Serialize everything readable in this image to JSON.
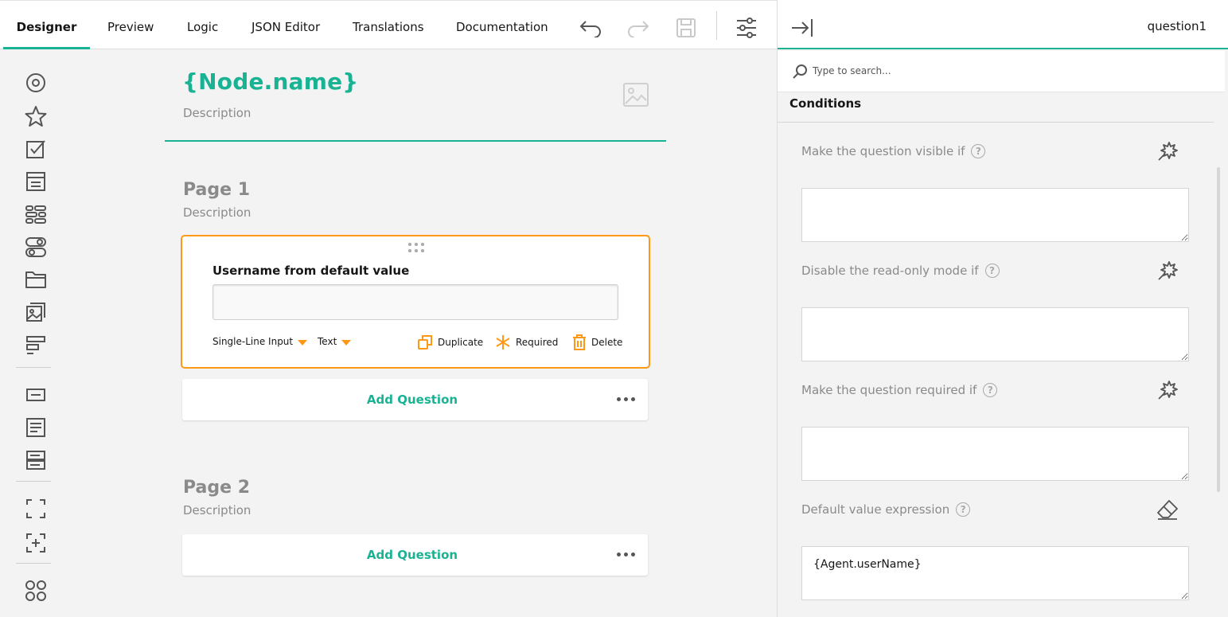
{
  "tabs": [
    {
      "label": "Designer"
    },
    {
      "label": "Preview"
    },
    {
      "label": "Logic"
    },
    {
      "label": "JSON Editor"
    },
    {
      "label": "Translations"
    },
    {
      "label": "Documentation"
    }
  ],
  "toolbar_icons": [
    "undo-icon",
    "redo-icon",
    "save-icon",
    "settings-sliders-icon"
  ],
  "toolbox_icons": [
    "radiogroup-icon",
    "rating-icon",
    "checkbox-icon",
    "dropdown-icon",
    "tagbox-icon",
    "boolean-icon",
    "file-icon",
    "image-picker-icon",
    "ranking-icon",
    "text-input-icon",
    "comment-icon",
    "multiple-text-icon",
    "panel-icon",
    "dynamic-panel-icon",
    "matrix-icon"
  ],
  "survey": {
    "title": "{Node.name}",
    "description": "Description"
  },
  "pages": [
    {
      "title": "Page 1",
      "description": "Description",
      "add_question": "Add Question"
    },
    {
      "title": "Page 2",
      "description": "Description",
      "add_question": "Add Question"
    }
  ],
  "question": {
    "title": "Username from default value",
    "type_label": "Single-Line Input",
    "input_type_label": "Text",
    "duplicate_label": "Duplicate",
    "required_label": "Required",
    "delete_label": "Delete"
  },
  "right_panel": {
    "selected_name": "question1",
    "search_placeholder": "Type to search...",
    "section": "Conditions",
    "properties": [
      {
        "label": "Make the question visible if",
        "value": ""
      },
      {
        "label": "Disable the read-only mode if",
        "value": ""
      },
      {
        "label": "Make the question required if",
        "value": ""
      },
      {
        "label": "Default value expression",
        "value": "{Agent.userName}"
      }
    ],
    "help_glyph": "?"
  },
  "colors": {
    "accent": "#19b394",
    "selection": "#ff9814",
    "muted": "#8a8a8a"
  }
}
